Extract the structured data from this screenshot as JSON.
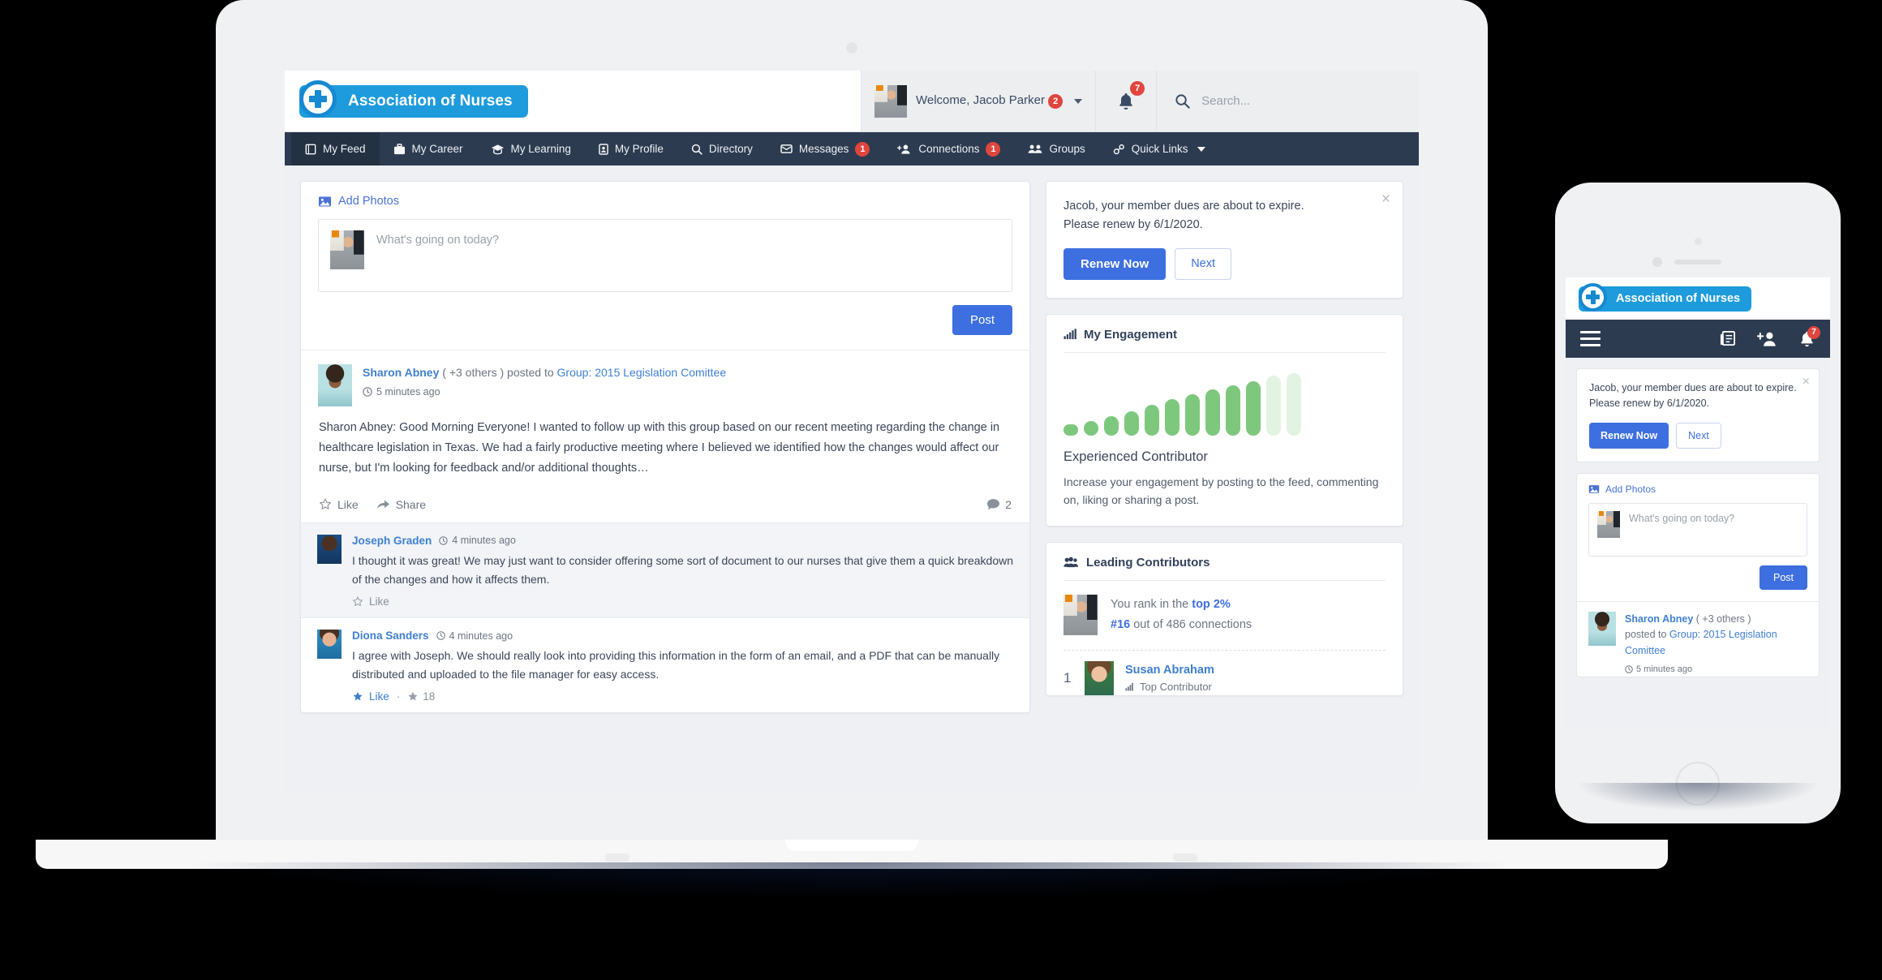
{
  "brand": {
    "name": "Association of Nurses",
    "accent": "#1d9bdc",
    "primary": "#3d6fe0",
    "nav_bg": "#2c3b50",
    "badge_red": "#e0453e"
  },
  "header": {
    "welcome": "Welcome, Jacob Parker",
    "welcome_badge": "2",
    "notifications_badge": "7",
    "search_placeholder": "Search..."
  },
  "nav": {
    "items": [
      {
        "label": "My Feed",
        "icon": "feed-icon",
        "badge": "",
        "active": true
      },
      {
        "label": "My Career",
        "icon": "briefcase-icon",
        "badge": "",
        "active": false
      },
      {
        "label": "My Learning",
        "icon": "graduation-cap-icon",
        "badge": "",
        "active": false
      },
      {
        "label": "My Profile",
        "icon": "id-badge-icon",
        "badge": "",
        "active": false
      },
      {
        "label": "Directory",
        "icon": "search-icon",
        "badge": "",
        "active": false
      },
      {
        "label": "Messages",
        "icon": "envelope-icon",
        "badge": "1",
        "active": false
      },
      {
        "label": "Connections",
        "icon": "user-plus-icon",
        "badge": "1",
        "active": false
      },
      {
        "label": "Groups",
        "icon": "users-icon",
        "badge": "",
        "active": false
      },
      {
        "label": "Quick Links",
        "icon": "link-icon",
        "badge": "",
        "active": false,
        "caret": true
      }
    ]
  },
  "composer": {
    "add_photos": "Add Photos",
    "placeholder": "What's going on today?",
    "value": "",
    "post_label": "Post"
  },
  "post": {
    "author": "Sharon Abney",
    "others": "( +3 others )",
    "posted_to": "posted to",
    "group": "Group: 2015 Legislation Comittee",
    "time": "5 minutes ago",
    "body": "Sharon Abney: Good Morning Everyone! I wanted to follow up with this group based on our recent meeting regarding the change in healthcare legislation in Texas. We had a fairly productive meeting where I believed we identified how the changes would affect our nurse, but I'm looking for feedback and/or additional thoughts…",
    "like_label": "Like",
    "share_label": "Share",
    "comment_count": "2"
  },
  "comments": [
    {
      "author": "Joseph Graden",
      "time": "4 minutes ago",
      "body": "I thought it was great! We may just want to consider offering some sort of document to our nurses that give them a quick breakdown of the changes and how it affects them.",
      "like_label": "Like",
      "liked": false,
      "like_count": ""
    },
    {
      "author": "Diona Sanders",
      "time": "4 minutes ago",
      "body": "I agree with Joseph. We should really look into providing this information in the form of an email, and a PDF that can be manually distributed and uploaded to the file manager for easy access.",
      "like_label": "Like",
      "liked": true,
      "like_count": "18"
    }
  ],
  "notice": {
    "line1": "Jacob, your member dues are about to expire.",
    "line2": "Please renew by 6/1/2020.",
    "mobile_text": "Jacob, your member dues are about to expire. Please renew by 6/1/2020.",
    "renew_label": "Renew Now",
    "next_label": "Next",
    "close": "×"
  },
  "engagement": {
    "title": "My Engagement",
    "level": "Experienced Contributor",
    "description": "Increase your engagement by posting to the feed, commenting on, liking or sharing a post."
  },
  "chart_data": {
    "type": "bar",
    "title": "My Engagement",
    "categories": [
      "1",
      "2",
      "3",
      "4",
      "5",
      "6",
      "7",
      "8",
      "9",
      "10",
      "11",
      "12"
    ],
    "values": [
      16,
      21,
      28,
      35,
      45,
      53,
      60,
      68,
      74,
      80,
      88,
      92
    ],
    "filled": [
      true,
      true,
      true,
      true,
      true,
      true,
      true,
      true,
      true,
      true,
      false,
      false
    ],
    "colors": {
      "filled": "#7ec87e",
      "empty": "#e3f3e3"
    },
    "ylim": [
      0,
      100
    ],
    "xlabel": "",
    "ylabel": "",
    "grid": false,
    "legend": "none"
  },
  "leading": {
    "title": "Leading Contributors",
    "rank_prefix": "You rank in the",
    "rank_pct": "top 2%",
    "rank_number": "#16",
    "rank_suffix": "out of 486 connections",
    "rows": [
      {
        "rank": "1",
        "name": "Susan Abraham",
        "role": "Top Contributor"
      }
    ]
  },
  "mobile": {
    "brand": "Association of Nurses",
    "notifications_badge": "7",
    "add_photos": "Add Photos",
    "placeholder": "What's going on today?",
    "post_label": "Post",
    "feed": {
      "author": "Sharon Abney",
      "others": "( +3 others )",
      "posted_to": "posted to",
      "group": "Group: 2015 Legislation Comittee",
      "time": "5 minutes ago"
    }
  }
}
